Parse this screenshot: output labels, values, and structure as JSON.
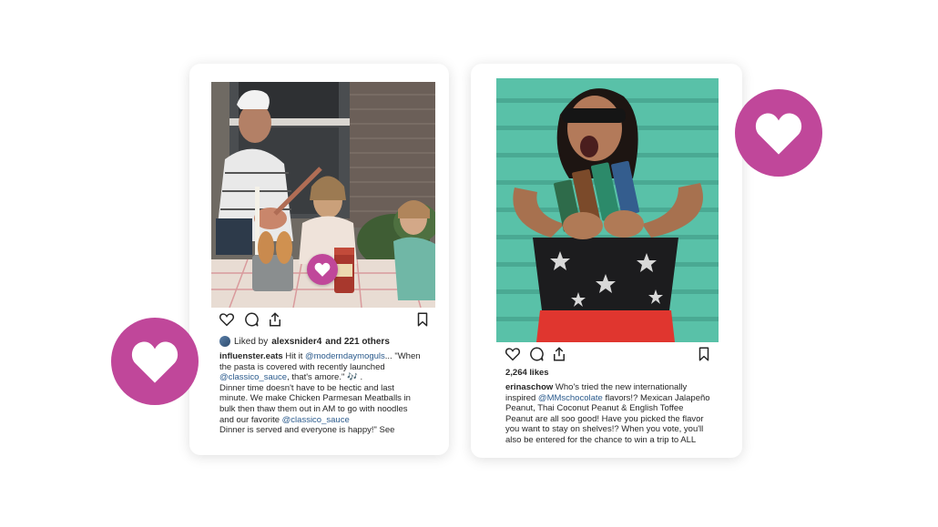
{
  "post1": {
    "liked_prefix": "Liked by",
    "liked_user": "alexsnider4",
    "liked_suffix": "and 221 others",
    "caption_lines": [
      [
        {
          "t": "influenster.eats",
          "c": "user"
        },
        {
          "t": " Hit it ",
          "c": ""
        },
        {
          "t": "@moderndaymoguls",
          "c": "mention"
        },
        {
          "t": "... \"When",
          "c": ""
        }
      ],
      [
        {
          "t": "the pasta is covered with recently launched",
          "c": ""
        }
      ],
      [
        {
          "t": "@classico_sauce",
          "c": "mention"
        },
        {
          "t": ", that's amore.\" 🎶 .",
          "c": ""
        }
      ],
      [
        {
          "t": "Dinner time doesn't have to be hectic and last",
          "c": ""
        }
      ],
      [
        {
          "t": "minute. We make Chicken Parmesan Meatballs in",
          "c": ""
        }
      ],
      [
        {
          "t": "bulk then thaw them out in AM to go with noodles",
          "c": ""
        }
      ],
      [
        {
          "t": "and our favorite ",
          "c": ""
        },
        {
          "t": "@classico_sauce",
          "c": "mention"
        }
      ],
      [
        {
          "t": "Dinner is served and everyone is happy!\" See",
          "c": ""
        }
      ]
    ]
  },
  "post2": {
    "likes": "2,264 likes",
    "caption_lines": [
      [
        {
          "t": "erinaschow",
          "c": "user"
        },
        {
          "t": " Who's tried the new internationally",
          "c": ""
        }
      ],
      [
        {
          "t": "inspired ",
          "c": ""
        },
        {
          "t": "@MMschocolate",
          "c": "mention"
        },
        {
          "t": " flavors!? Mexican Jalapeño",
          "c": ""
        }
      ],
      [
        {
          "t": "Peanut, Thai Coconut Peanut & English Toffee",
          "c": ""
        }
      ],
      [
        {
          "t": "Peanut are all soo good! Have you picked the flavor",
          "c": ""
        }
      ],
      [
        {
          "t": "you want to stay on shelves!? When you vote, you'll",
          "c": ""
        }
      ],
      [
        {
          "t": "also be entered for the chance to win a trip to ALL",
          "c": ""
        }
      ]
    ]
  },
  "colors": {
    "accent": "#c0479a",
    "mention": "#2a5a8c"
  }
}
